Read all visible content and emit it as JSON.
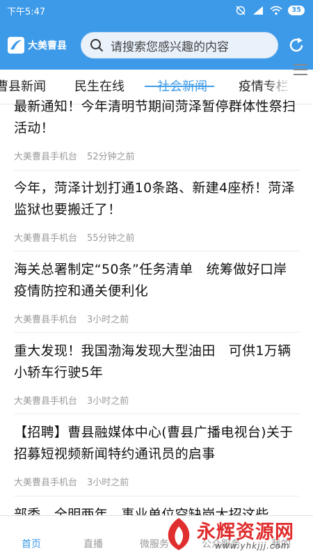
{
  "status_bar": {
    "time": "下午5:47",
    "battery": "35"
  },
  "header": {
    "logo_text": "大美曹县",
    "search_placeholder": "请搜索您感兴趣的内容"
  },
  "tabs": [
    "曹县新闻",
    "民生在线",
    "社会新闻",
    "疫情专栏"
  ],
  "active_tab": "社会新闻",
  "news": [
    {
      "title": "最新通知！今年清明节期间菏泽暂停群体性祭扫活动！",
      "source": "大美曹县手机台",
      "time": "52分钟之前"
    },
    {
      "title": "今年，菏泽计划打通10条路、新建4座桥！菏泽监狱也要搬迁了！",
      "source": "大美曹县手机台",
      "time": "55分钟之前"
    },
    {
      "title": "海关总署制定“50条”任务清单　统筹做好口岸疫情防控和通关便利化",
      "source": "大美曹县手机台",
      "time": "3小时之前"
    },
    {
      "title": "重大发现！我国渤海发现大型油田　可供1万辆小轿车行驶5年",
      "source": "大美曹县手机台",
      "time": "3小时之前"
    },
    {
      "title": "【招聘】曹县融媒体中心(曹县广播电视台)关于招募短视频新闻特约通讯员的启事",
      "source": "大美曹县手机台",
      "time": "3小时之前"
    },
    {
      "title": "部委、全明两年，事业单位空缺岗大招这些",
      "source": "",
      "time": ""
    }
  ],
  "bottom_nav": [
    "首页",
    "直播",
    "微服务",
    "公众服务",
    "我的"
  ],
  "watermark": {
    "title": "永辉资源网",
    "url": "www.yhkjjj.com"
  },
  "colors": {
    "accent": "#3d9ae8",
    "watermark": "#e02d2d"
  }
}
